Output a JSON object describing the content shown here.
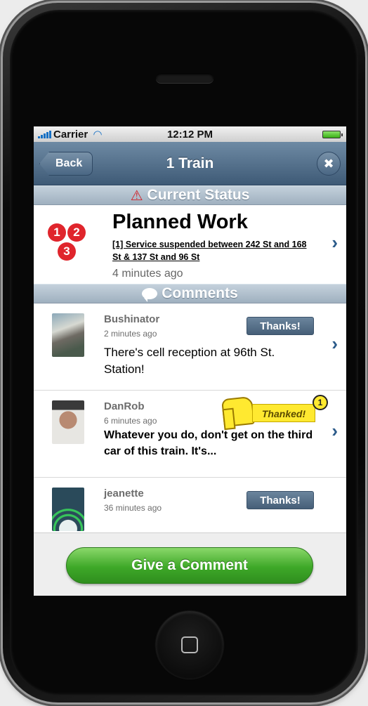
{
  "status_bar": {
    "carrier": "Carrier",
    "time": "12:12 PM"
  },
  "nav": {
    "back_label": "Back",
    "title": "1 Train",
    "close_label": "✖"
  },
  "current_status": {
    "header": "Current Status",
    "header_icon": "warning-icon",
    "line_badges": [
      "1",
      "2",
      "3"
    ],
    "title": "Planned Work",
    "description": "[1] Service suspended between 242 St and 168 St & 137 St and 96 St",
    "time": "4 minutes ago",
    "chevron": "›"
  },
  "comments": {
    "header": "Comments",
    "header_icon": "speech-bubble-icon",
    "items": [
      {
        "user": "Bushinator",
        "time": "2 minutes ago",
        "text": "There's cell reception at 96th St. Station!",
        "button_label": "Thanks!",
        "chevron": "›"
      },
      {
        "user": "DanRob",
        "time": "6 minutes ago",
        "text": "Whatever you do, don't get on the third car of this train. It's...",
        "button_label": "Thanked!",
        "thanks_count": "1",
        "chevron": "›"
      },
      {
        "user": "jeanette",
        "time": "36 minutes ago",
        "button_label": "Thanks!"
      }
    ]
  },
  "footer": {
    "give_comment_label": "Give a Comment"
  },
  "colors": {
    "nav_top": "#6e8aa4",
    "nav_bottom": "#3e5a76",
    "badge_red": "#e0252c",
    "button_green": "#3ea828",
    "thanked_yellow": "#ffe930",
    "chevron_blue": "#2c5b8a"
  }
}
